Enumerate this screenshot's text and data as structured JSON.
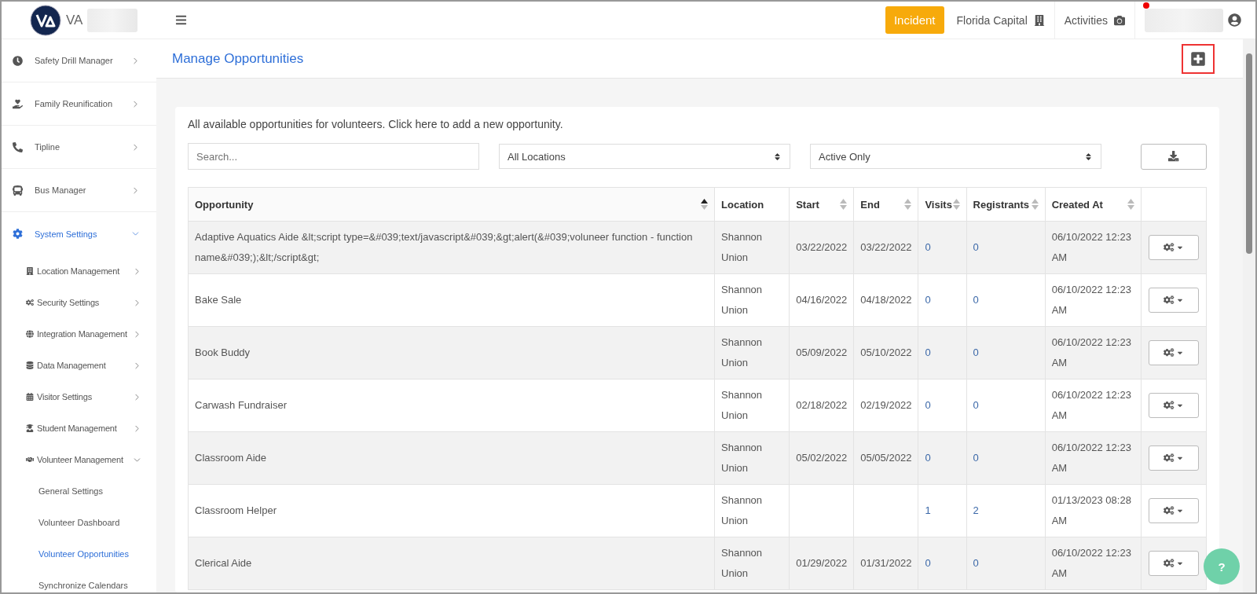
{
  "header": {
    "brand": "VA",
    "incident_button": "Incident",
    "location": "Florida Capital",
    "activities": "Activities",
    "notification": true
  },
  "sidebar": {
    "items": [
      {
        "label": "Safety Drill Manager",
        "expanded": false,
        "selected": false
      },
      {
        "label": "Family Reunification",
        "expanded": false,
        "selected": false
      },
      {
        "label": "Tipline",
        "expanded": false,
        "selected": false
      },
      {
        "label": "Bus Manager",
        "expanded": false,
        "selected": false
      },
      {
        "label": "System Settings",
        "expanded": true,
        "selected": true,
        "children": [
          {
            "label": "Location Management",
            "expanded": false,
            "selected": false
          },
          {
            "label": "Security Settings",
            "expanded": false,
            "selected": false
          },
          {
            "label": "Integration Management",
            "expanded": false,
            "selected": false
          },
          {
            "label": "Data Management",
            "expanded": false,
            "selected": false
          },
          {
            "label": "Visitor Settings",
            "expanded": false,
            "selected": false
          },
          {
            "label": "Student Management",
            "expanded": false,
            "selected": false
          },
          {
            "label": "Volunteer Management",
            "expanded": true,
            "selected": false,
            "children": [
              {
                "label": "General Settings",
                "selected": false
              },
              {
                "label": "Volunteer Dashboard",
                "selected": false
              },
              {
                "label": "Volunteer Opportunities",
                "selected": true
              },
              {
                "label": "Synchronize Calendars",
                "selected": false
              }
            ]
          }
        ]
      }
    ]
  },
  "page": {
    "title": "Manage Opportunities",
    "intro": "All available opportunities for volunteers. Click here to add a new opportunity.",
    "search": {
      "placeholder": "Search..."
    },
    "location_filter": "All Locations",
    "status_filter": "Active Only"
  },
  "table": {
    "columns": [
      {
        "label": "Opportunity",
        "sortable": true,
        "sorted": true
      },
      {
        "label": "Location",
        "sortable": false
      },
      {
        "label": "Start",
        "sortable": true,
        "sorted": false
      },
      {
        "label": "End",
        "sortable": true,
        "sorted": false
      },
      {
        "label": "Visits",
        "sortable": true,
        "sorted": false
      },
      {
        "label": "Registrants",
        "sortable": true,
        "sorted": false
      },
      {
        "label": "Created At",
        "sortable": true,
        "sorted": false
      }
    ],
    "rows": [
      {
        "opportunity": "Adaptive Aquatics Aide &lt;script type=&#039;text/javascript&#039;&gt;alert(&#039;voluneer function - function name&#039;);&lt;/script&gt;",
        "location": "Shannon Union",
        "start": "03/22/2022",
        "end": "03/22/2022",
        "visits": "0",
        "registrants": "0",
        "created_at": "06/10/2022 12:23 AM"
      },
      {
        "opportunity": "Bake Sale",
        "location": "Shannon Union",
        "start": "04/16/2022",
        "end": "04/18/2022",
        "visits": "0",
        "registrants": "0",
        "created_at": "06/10/2022 12:23 AM"
      },
      {
        "opportunity": "Book Buddy",
        "location": "Shannon Union",
        "start": "05/09/2022",
        "end": "05/10/2022",
        "visits": "0",
        "registrants": "0",
        "created_at": "06/10/2022 12:23 AM"
      },
      {
        "opportunity": "Carwash Fundraiser",
        "location": "Shannon Union",
        "start": "02/18/2022",
        "end": "02/19/2022",
        "visits": "0",
        "registrants": "0",
        "created_at": "06/10/2022 12:23 AM"
      },
      {
        "opportunity": "Classroom Aide",
        "location": "Shannon Union",
        "start": "05/02/2022",
        "end": "05/05/2022",
        "visits": "0",
        "registrants": "0",
        "created_at": "06/10/2022 12:23 AM"
      },
      {
        "opportunity": "Classroom Helper",
        "location": "Shannon Union",
        "visits": "1",
        "registrants": "2",
        "created_at": "01/13/2023 08:28 AM"
      },
      {
        "opportunity": "Clerical Aide",
        "location": "Shannon Union",
        "start": "01/29/2022",
        "end": "01/31/2022",
        "visits": "0",
        "registrants": "0",
        "created_at": "06/10/2022 12:23 AM"
      }
    ]
  },
  "help_button": "?"
}
